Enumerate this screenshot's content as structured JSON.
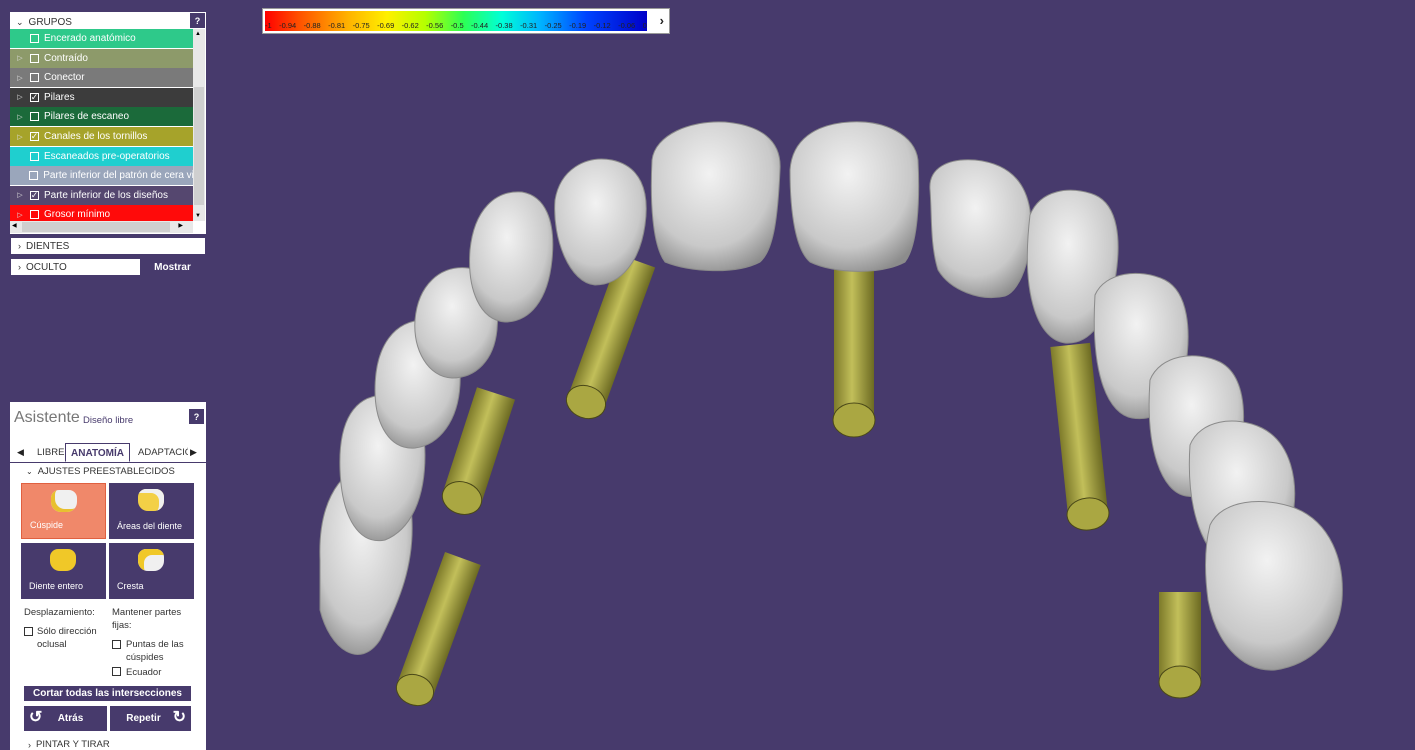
{
  "colorbar": {
    "ticks": [
      "-1",
      "-0.94",
      "-0.88",
      "-0.81",
      "-0.75",
      "-0.69",
      "-0.62",
      "-0.56",
      "-0.5",
      "-0.44",
      "-0.38",
      "-0.31",
      "-0.25",
      "-0.19",
      "-0.12",
      "-0.06",
      "0"
    ]
  },
  "groups": {
    "title": "GRUPOS",
    "help": "?",
    "items": [
      {
        "label": "Encerado anatómico",
        "checked": false,
        "color": "#2ec98a"
      },
      {
        "label": "Contraído",
        "checked": false,
        "color": "#8d9a6a"
      },
      {
        "label": "Conector",
        "checked": false,
        "color": "#7a7a7a"
      },
      {
        "label": "Pilares",
        "checked": true,
        "color": "#3c3c3c"
      },
      {
        "label": "Pilares de escaneo",
        "checked": false,
        "color": "#1b6a3a"
      },
      {
        "label": "Canales de los tornillos",
        "checked": true,
        "color": "#a6a32a"
      },
      {
        "label": "Escaneados pre-operatorios",
        "checked": false,
        "color": "#1fcfcf"
      },
      {
        "label": "Parte inferior del patrón de cera vir",
        "checked": false,
        "color": "#9aa6bb"
      },
      {
        "label": "Parte inferior de los diseños",
        "checked": true,
        "color": "#55476f"
      },
      {
        "label": "Grosor mínimo",
        "checked": false,
        "color": "#ff0a0a"
      }
    ]
  },
  "dientes": {
    "label": "DIENTES"
  },
  "oculto": {
    "label": "OCULTO",
    "button": "Mostrar"
  },
  "assistant": {
    "title": "Asistente",
    "subtitle": "Diseño libre",
    "help": "?",
    "tabs": [
      "LIBRE",
      "ANATOMÍA",
      "ADAPTACIÓ"
    ],
    "section": "AJUSTES PREESTABLECIDOS",
    "tiles": [
      {
        "label": "Cúspide",
        "active": true
      },
      {
        "label": "Áreas del diente",
        "active": false
      },
      {
        "label": "Diente entero",
        "active": false
      },
      {
        "label": "Cresta",
        "active": false
      }
    ],
    "desplazamiento": "Desplazamiento:",
    "solo1": "Sólo dirección",
    "solo2": "oclusal",
    "mantener1": "Mantener partes",
    "mantener2": "fijas:",
    "puntas1": "Puntas de las",
    "puntas2": "cúspides",
    "ecuador": "Ecuador",
    "cortar": "Cortar todas las intersecciones",
    "atras": "Atrás",
    "repetir": "Repetir",
    "pintar": "PINTAR Y TIRAR"
  }
}
